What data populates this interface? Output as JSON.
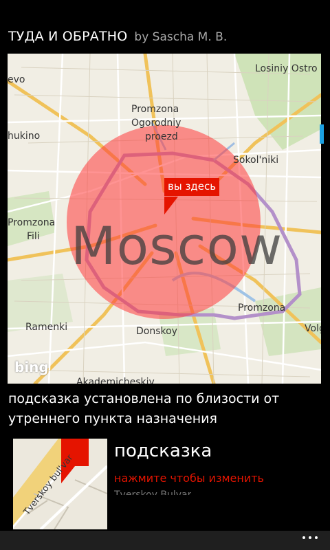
{
  "header": {
    "title": "ТУДА И ОБРАТНО",
    "author": "by Sascha M. B."
  },
  "map": {
    "city_label": "Moscow",
    "marker_label": "вы здесь",
    "attribution": "bing",
    "places": {
      "losiny": "Losiniy Ostro",
      "evo": "evo",
      "promzona_top": "Promzona",
      "ogorodniy": "Ogorodniy",
      "proezd": "proezd",
      "nukino": "hukino",
      "sokolniki": "Sokol'niki",
      "promzona_left": "Promzona",
      "fili": "Fili",
      "promzona_right": "Promzona",
      "ramenki": "Ramenki",
      "donskoy": "Donskoy",
      "volg": "Volg",
      "akadem": "Akademicheskiy"
    },
    "colors": {
      "zone": "#ff3b3b",
      "marker": "#e51400"
    }
  },
  "hint": {
    "description": "подсказка установлена по близости от утреннего пункта назначения",
    "title": "подсказка",
    "action": "нажмите чтобы изменить",
    "extra": "Tverskoy Bulvar",
    "thumb_street": "Tverskoy bul'var"
  },
  "appbar": {
    "more_icon": "ellipsis-icon"
  }
}
